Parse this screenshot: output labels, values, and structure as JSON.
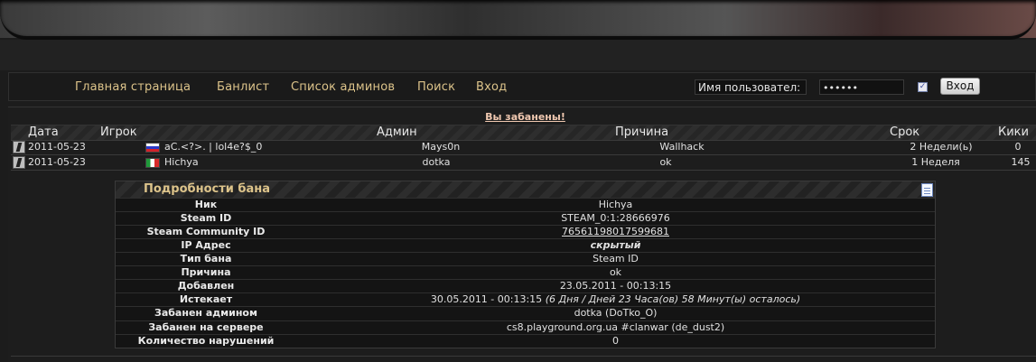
{
  "nav": {
    "home": "Главная страница",
    "banlist": "Банлист",
    "admins": "Список админов",
    "search": "Поиск",
    "login": "Вход"
  },
  "login_form": {
    "username_placeholder": "Имя пользовател:",
    "password_value": "••••••",
    "remember_checked": true,
    "submit_label": "Вход"
  },
  "alert": "Вы забанены!",
  "table": {
    "headers": {
      "date": "Дата",
      "player": "Игрок",
      "admin": "Админ",
      "reason": "Причина",
      "term": "Срок",
      "kicks": "Кики"
    },
    "rows": [
      {
        "date": "2011-05-23",
        "flag": "ru",
        "player": "aC.<?>. | lol4e?$_0",
        "admin": "Mays0n",
        "reason": "Wallhack",
        "term": "2 Недели(ь)",
        "kicks": "0"
      },
      {
        "date": "2011-05-23",
        "flag": "it",
        "player": "Hichya",
        "admin": "dotka",
        "reason": "ok",
        "term": "1 Неделя",
        "kicks": "145"
      }
    ]
  },
  "details": {
    "title": "Подробности бана",
    "rows": [
      {
        "label": "Ник",
        "value": "Hichya"
      },
      {
        "label": "Steam ID",
        "value": "STEAM_0:1:28666976"
      },
      {
        "label": "Steam Community ID",
        "value": "76561198017599681"
      },
      {
        "label": "IP Адрес",
        "value": "скрытый"
      },
      {
        "label": "Тип бана",
        "value": "Steam ID"
      },
      {
        "label": "Причина",
        "value": "ok"
      },
      {
        "label": "Добавлен",
        "value": "23.05.2011 - 00:13:15"
      },
      {
        "label": "Истекает",
        "value": "30.05.2011 - 00:13:15",
        "note": "(6 Дня / Дней 23 Часа(ов) 58 Минут(ы) осталось)"
      },
      {
        "label": "Забанен админом",
        "value": "dotka (DoTko_O)"
      },
      {
        "label": "Забанен на сервере",
        "value": "cs8.playground.org.ua #clanwar (de_dust2)"
      },
      {
        "label": "Количество нарушений",
        "value": "0"
      }
    ]
  },
  "colors": {
    "nav_link": "#dcc38a",
    "alert": "#f0c8b0",
    "background": "#1c1c1c"
  }
}
